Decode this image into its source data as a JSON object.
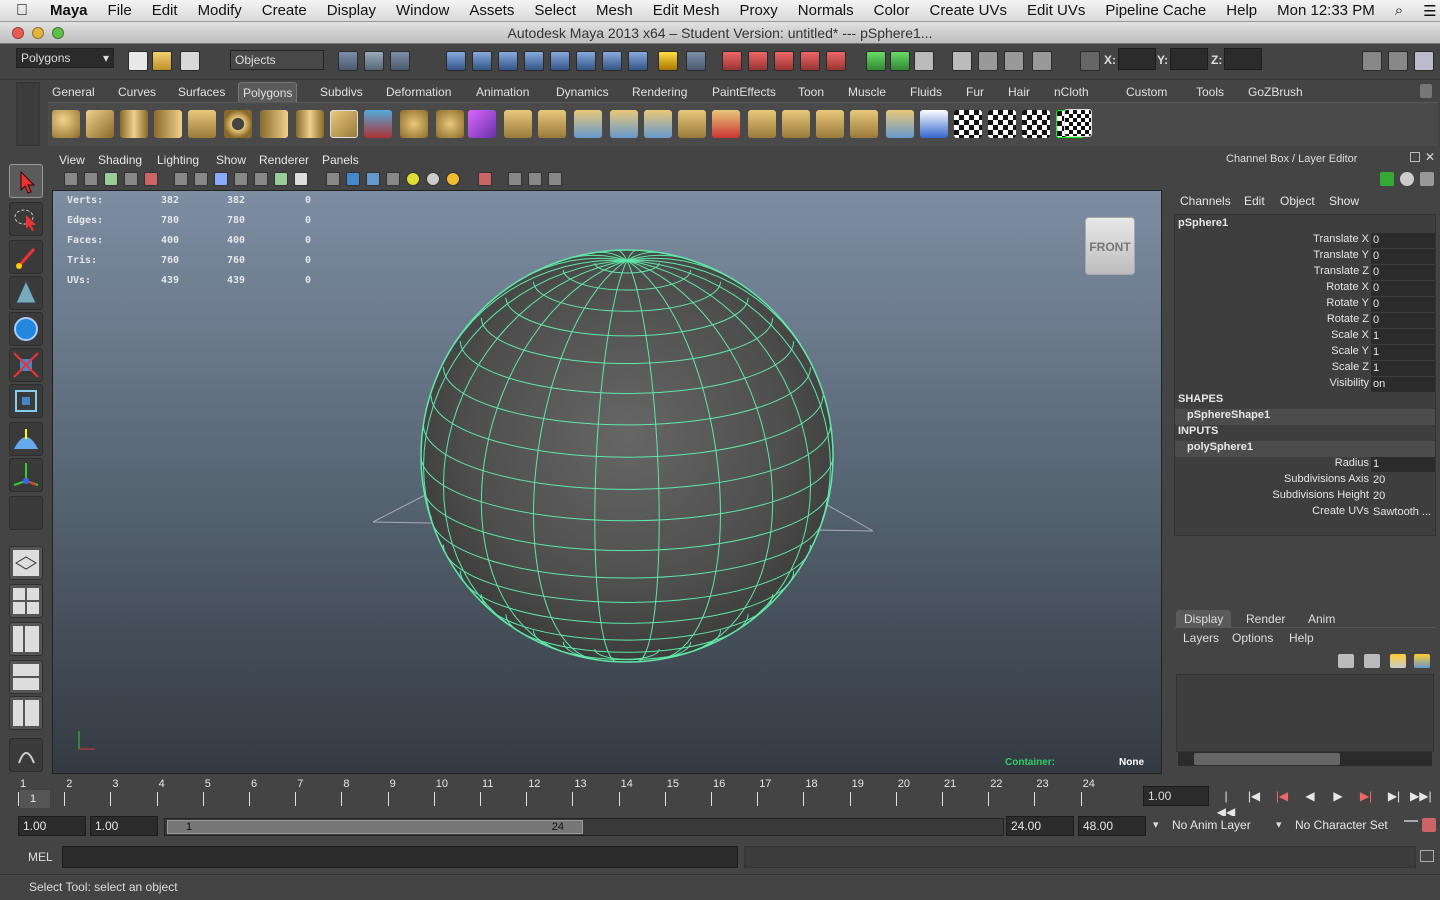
{
  "macbar": {
    "apple": "",
    "app": "Maya",
    "menus": [
      "File",
      "Edit",
      "Modify",
      "Create",
      "Display",
      "Window",
      "Assets",
      "Select",
      "Mesh",
      "Edit Mesh",
      "Proxy",
      "Normals",
      "Color",
      "Create UVs",
      "Edit UVs",
      "Pipeline Cache",
      "Help"
    ],
    "clock": "Mon 12:33 PM",
    "search": "⌕",
    "list": "☰"
  },
  "window": {
    "title": "Autodesk Maya 2013 x64 – Student Version: untitled*   ---   pSphere1..."
  },
  "statusline": {
    "menuset": "Polygons",
    "selmode": "Objects",
    "x_label": "X:",
    "y_label": "Y:",
    "z_label": "Z:"
  },
  "shelf": {
    "tabs": [
      "General",
      "Curves",
      "Surfaces",
      "Polygons",
      "Subdivs",
      "Deformation",
      "Animation",
      "Dynamics",
      "Rendering",
      "PaintEffects",
      "Toon",
      "Muscle",
      "Fluids",
      "Fur",
      "Hair",
      "nCloth",
      "Custom",
      "Tools",
      "GoZBrush"
    ],
    "active": "Polygons"
  },
  "panel": {
    "menus": [
      "View",
      "Shading",
      "Lighting",
      "Show",
      "Renderer",
      "Panels"
    ]
  },
  "hud": {
    "rows": [
      {
        "label": "Verts:",
        "a": "382",
        "b": "382",
        "c": "0"
      },
      {
        "label": "Edges:",
        "a": "780",
        "b": "780",
        "c": "0"
      },
      {
        "label": "Faces:",
        "a": "400",
        "b": "400",
        "c": "0"
      },
      {
        "label": "Tris:",
        "a": "760",
        "b": "760",
        "c": "0"
      },
      {
        "label": "UVs:",
        "a": "439",
        "b": "439",
        "c": "0"
      }
    ],
    "viewcube": "FRONT",
    "container_label": "Container:",
    "container_value": "None"
  },
  "channelbox": {
    "title": "Channel Box / Layer Editor",
    "menus": [
      "Channels",
      "Edit",
      "Object",
      "Show"
    ],
    "object": "pSphere1",
    "attrs": [
      {
        "label": "Translate X",
        "value": "0"
      },
      {
        "label": "Translate Y",
        "value": "0"
      },
      {
        "label": "Translate Z",
        "value": "0"
      },
      {
        "label": "Rotate X",
        "value": "0"
      },
      {
        "label": "Rotate Y",
        "value": "0"
      },
      {
        "label": "Rotate Z",
        "value": "0"
      },
      {
        "label": "Scale X",
        "value": "1"
      },
      {
        "label": "Scale Y",
        "value": "1"
      },
      {
        "label": "Scale Z",
        "value": "1"
      },
      {
        "label": "Visibility",
        "value": "on"
      }
    ],
    "shapes_header": "SHAPES",
    "shape": "pSphereShape1",
    "inputs_header": "INPUTS",
    "input": "polySphere1",
    "input_attrs": [
      {
        "label": "Radius",
        "value": "1"
      },
      {
        "label": "Subdivisions Axis",
        "value": "20"
      },
      {
        "label": "Subdivisions Height",
        "value": "20"
      },
      {
        "label": "Create UVs",
        "value": "Sawtooth ..."
      }
    ]
  },
  "layers": {
    "tabs": [
      "Display",
      "Render",
      "Anim"
    ],
    "active": "Display",
    "menus": [
      "Layers",
      "Options",
      "Help"
    ]
  },
  "timeline": {
    "ticks": [
      "1",
      "2",
      "3",
      "4",
      "5",
      "6",
      "7",
      "8",
      "9",
      "10",
      "11",
      "12",
      "13",
      "14",
      "15",
      "16",
      "17",
      "18",
      "19",
      "20",
      "21",
      "22",
      "23",
      "24"
    ],
    "current": "1",
    "current_field": "1.00"
  },
  "range": {
    "start": "1.00",
    "playback_start": "1.00",
    "slider_start": "1",
    "slider_end": "24",
    "playback_end": "24.00",
    "end": "48.00",
    "anim_layer": "No Anim Layer",
    "char_set": "No Character Set"
  },
  "cmdline": {
    "label": "MEL"
  },
  "helpline": {
    "text": "Select Tool: select an object"
  }
}
